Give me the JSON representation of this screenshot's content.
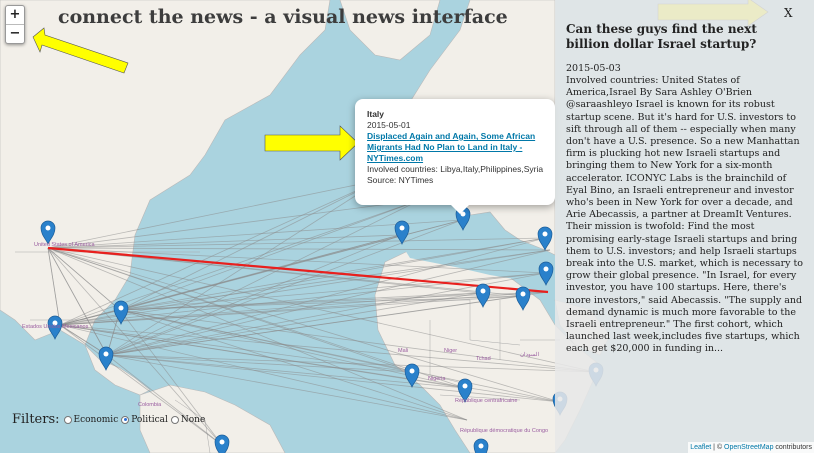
{
  "app": {
    "title": "connect the news - a visual news interface"
  },
  "zoom": {
    "in_label": "+",
    "out_label": "−"
  },
  "map_labels": [
    {
      "name": "label-united-states",
      "text": "United States of America"
    },
    {
      "name": "label-mexico",
      "text": "Estados Unidos Mexicanos"
    },
    {
      "name": "label-colombia",
      "text": "Colombia"
    },
    {
      "name": "label-mali",
      "text": "Mali"
    },
    {
      "name": "label-niger",
      "text": "Niger"
    },
    {
      "name": "label-tchad",
      "text": "Tchad"
    },
    {
      "name": "label-sudan",
      "text": "السودان"
    },
    {
      "name": "label-car",
      "text": "République centrafricaine"
    },
    {
      "name": "label-congo",
      "text": "République démocratique du Congo"
    },
    {
      "name": "label-nigeria",
      "text": "Nigeria"
    }
  ],
  "popup": {
    "country": "Italy",
    "date": "2015-05-01",
    "headline": "Displaced Again and Again, Some African Migrants Had No Plan to Land in Italy - NYTimes.com",
    "countries": "Involved countries: Libya,Italy,Philippines,Syria",
    "source": "Source: NYTimes"
  },
  "panel": {
    "close_label": "X",
    "title": "Can these guys find the next billion dollar Israel startup?",
    "date": "2015-05-03",
    "body": "Involved countries: United States of America,Israel By Sara Ashley O'Brien @saraashleyo Israel is known for its robust startup scene. But it's hard for U.S. investors to sift through all of them -- especially when many don't have a U.S. presence. So a new Manhattan firm is plucking hot new Israeli startups and bringing them to New York for a six-month accelerator. ICONYC Labs is the brainchild of Eyal Bino, an Israeli entrepreneur and investor who's been in New York for over a decade, and Arie Abecassis, a partner at DreamIt Ventures. Their mission is twofold: Find the most promising early-stage Israeli startups and bring them to U.S. investors; and help Israeli startups break into the U.S. market, which is necessary to grow their global presence. \"In Israel, for every investor, you have 100 startups. Here, there's more investors,\" said Abecassis. \"The supply and demand dynamic is much more favorable to the Israeli entrepreneur.\" The first cohort, which launched last week,includes five startups, which each get $20,000 in funding in..."
  },
  "filters": {
    "label": "Filters:",
    "options": [
      "Economic",
      "Political",
      "None"
    ],
    "selected": "Political"
  },
  "attribution": {
    "leaflet": "Leaflet",
    "sep": " | © ",
    "osm": "OpenStreetMap",
    "suffix": " contributors"
  },
  "colors": {
    "ocean": "#aad3df",
    "land": "#f2efe9",
    "marker": "#2a81cb",
    "highlight_line": "#e8201e",
    "arrow": "#ffff00"
  }
}
